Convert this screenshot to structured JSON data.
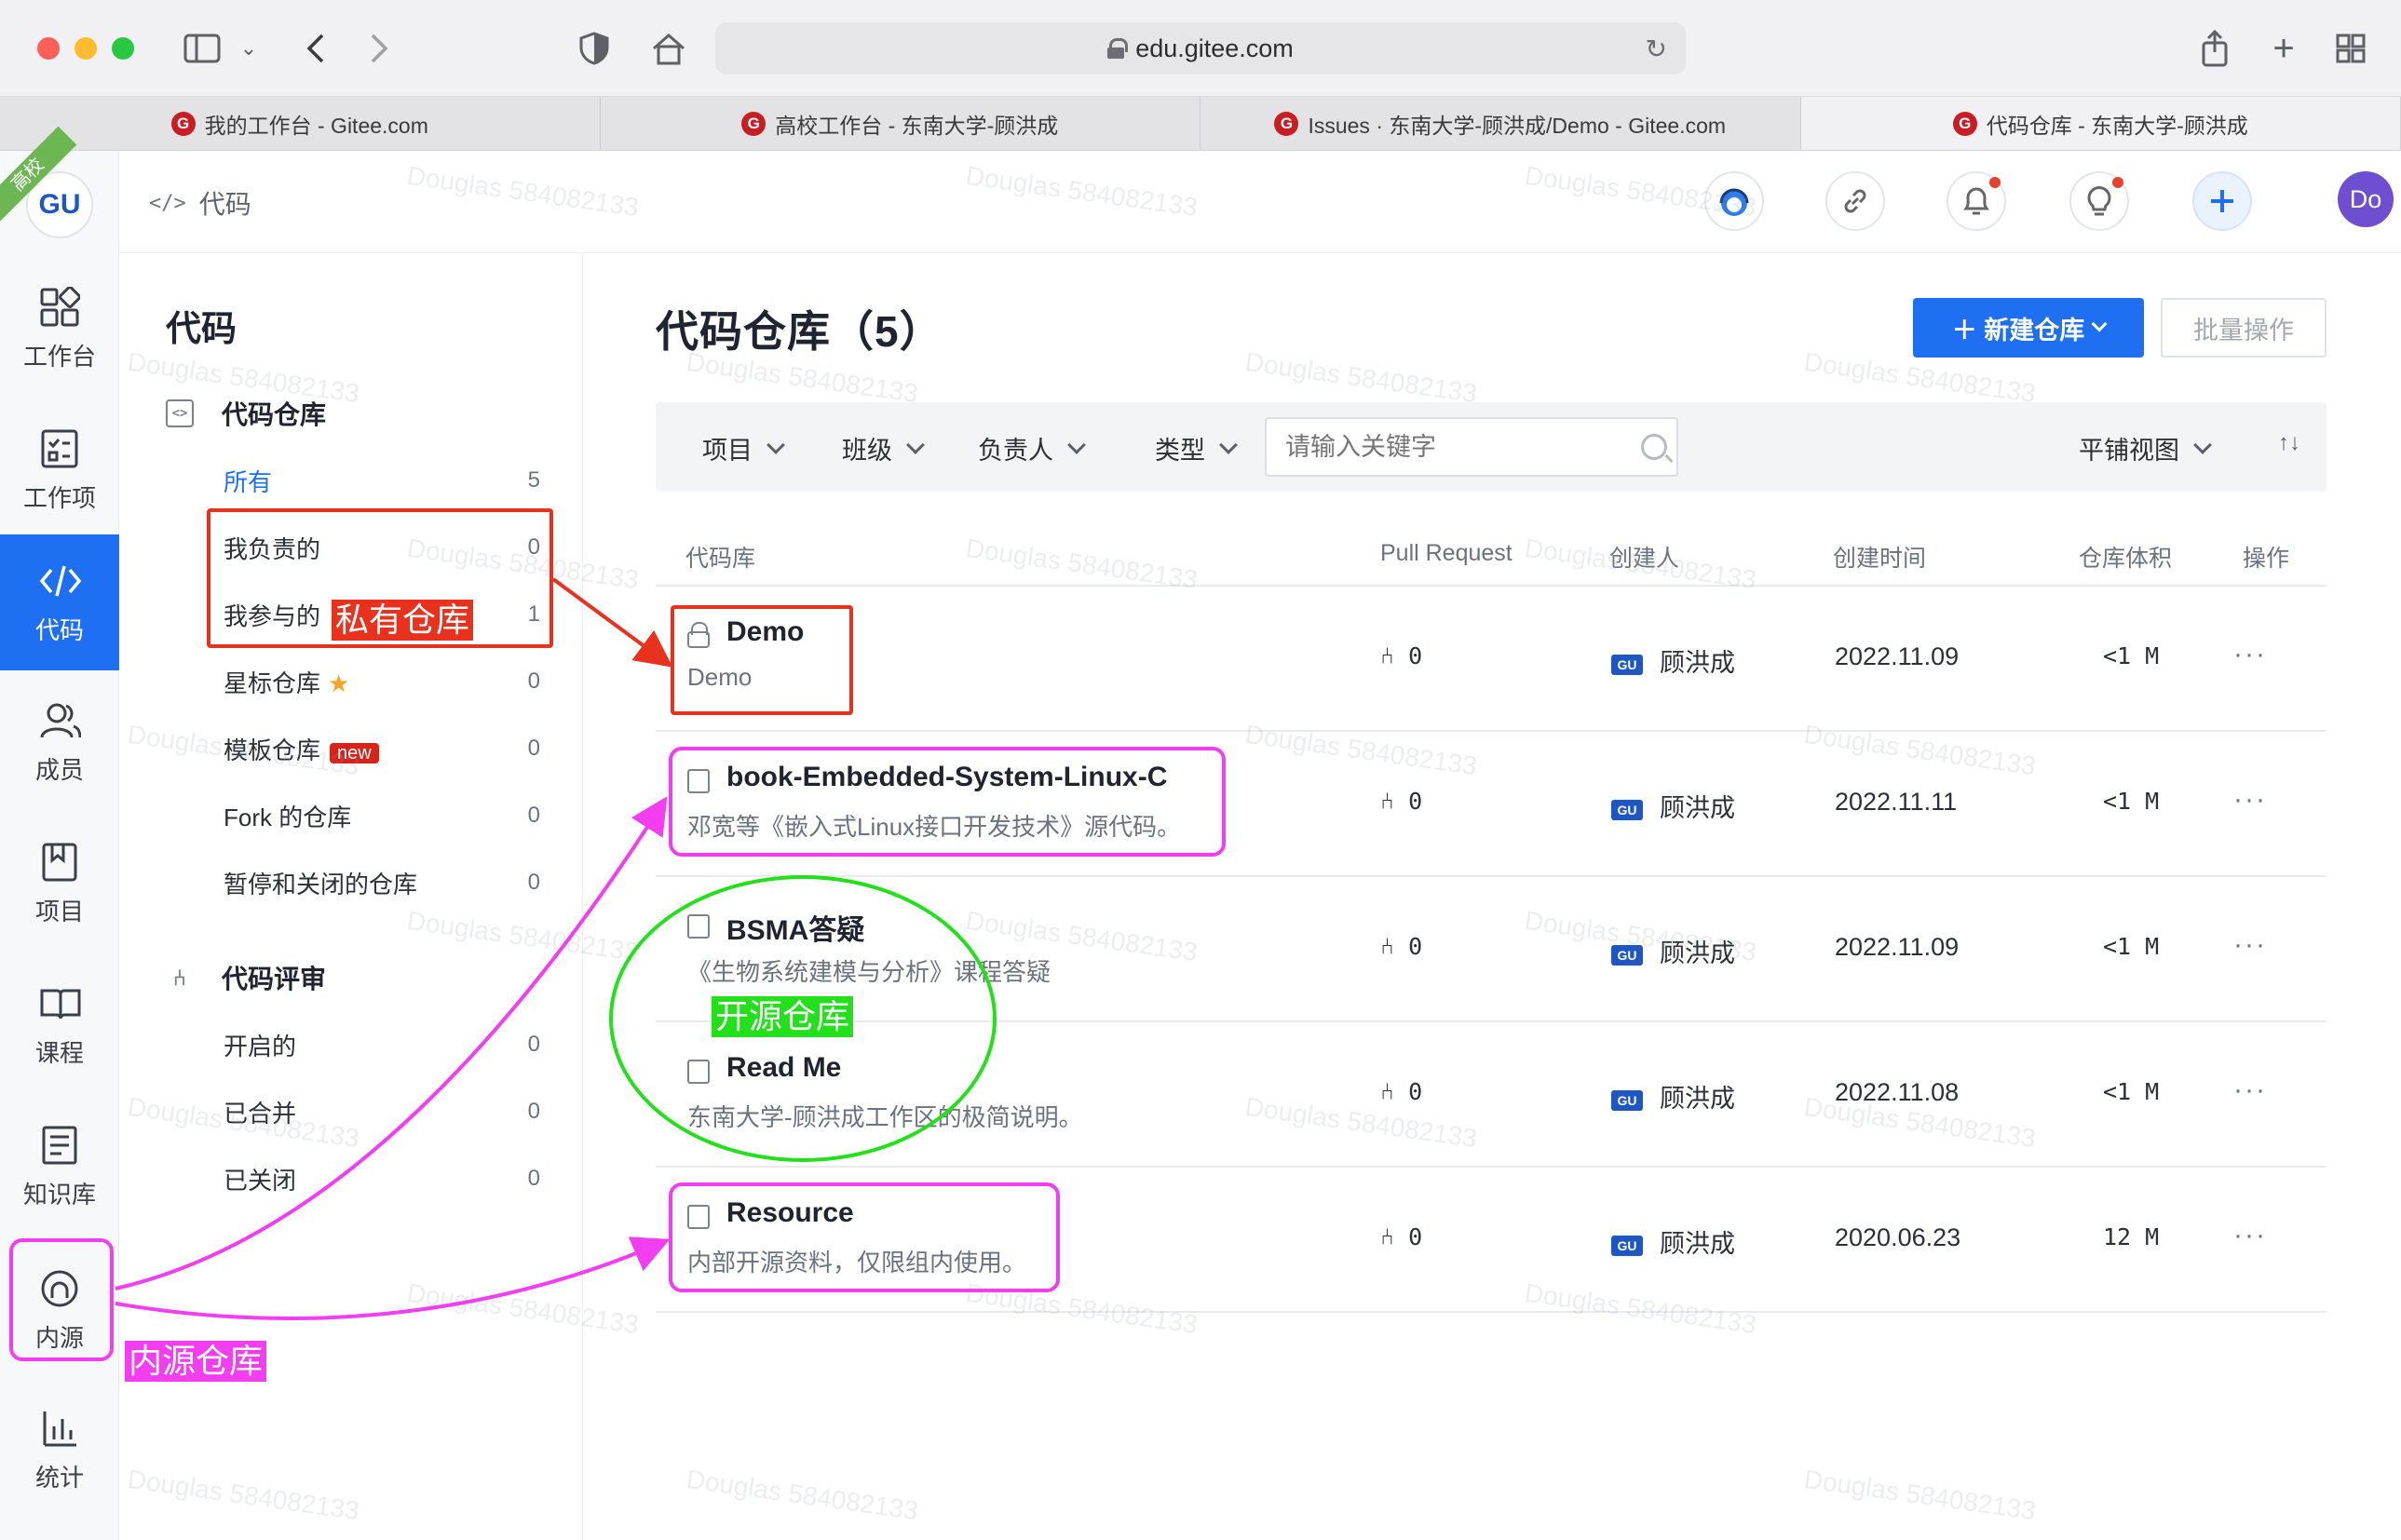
{
  "browser": {
    "url": "edu.gitee.com",
    "tabs": [
      {
        "title": "我的工作台 - Gitee.com",
        "icon": "gitee-icon"
      },
      {
        "title": "高校工作台 - 东南大学-顾洪成",
        "icon": "gitee-icon"
      },
      {
        "title": "Issues · 东南大学-顾洪成/Demo - Gitee.com",
        "icon": "gitee-icon"
      },
      {
        "title": "代码仓库 - 东南大学-顾洪成",
        "icon": "gitee-icon"
      }
    ],
    "active_tab": 3
  },
  "rail": {
    "ribbon": "高校",
    "logo_text": "GU",
    "items": [
      {
        "label": "工作台",
        "icon": "dashboard-icon"
      },
      {
        "label": "工作项",
        "icon": "checklist-icon"
      },
      {
        "label": "代码",
        "icon": "code-icon"
      },
      {
        "label": "成员",
        "icon": "members-icon"
      },
      {
        "label": "项目",
        "icon": "project-icon"
      },
      {
        "label": "课程",
        "icon": "course-icon"
      },
      {
        "label": "知识库",
        "icon": "knowledge-icon"
      },
      {
        "label": "内源",
        "icon": "innersource-icon"
      },
      {
        "label": "统计",
        "icon": "stats-icon"
      }
    ],
    "active": "代码"
  },
  "header": {
    "breadcrumb": "代码",
    "avatar_text": "Do"
  },
  "sidebar": {
    "title": "代码",
    "repo_group": "代码仓库",
    "repo_items": [
      {
        "label": "所有",
        "count": "5"
      },
      {
        "label": "我负责的",
        "count": "0"
      },
      {
        "label": "我参与的",
        "count": "1"
      },
      {
        "label": "星标仓库",
        "count": "0"
      },
      {
        "label": "模板仓库",
        "count": "0",
        "badge": "new"
      },
      {
        "label": "Fork 的仓库",
        "count": "0"
      },
      {
        "label": "暂停和关闭的仓库",
        "count": "0"
      }
    ],
    "review_group": "代码评审",
    "review_items": [
      {
        "label": "开启的",
        "count": "0"
      },
      {
        "label": "已合并",
        "count": "0"
      },
      {
        "label": "已关闭",
        "count": "0"
      }
    ]
  },
  "main": {
    "title": "代码仓库（5）",
    "new_repo_button": "＋ 新建仓库",
    "batch_button": "批量操作",
    "filters": [
      "项目",
      "班级",
      "负责人",
      "类型"
    ],
    "search_placeholder": "请输入关键字",
    "view_mode": "平铺视图",
    "sort_icon": "↑↓",
    "columns": [
      "代码库",
      "Pull Request",
      "创建人",
      "创建时间",
      "仓库体积",
      "操作"
    ],
    "rows": [
      {
        "name": "Demo",
        "desc": "Demo",
        "pr": "0",
        "creator": "顾洪成",
        "created": "2022.11.09",
        "size": "<1 M",
        "icon": "lock-icon"
      },
      {
        "name": "book-Embedded-System-Linux-C",
        "desc": "邓宽等《嵌入式Linux接口开发技术》源代码。",
        "pr": "0",
        "creator": "顾洪成",
        "created": "2022.11.11",
        "size": "<1 M",
        "icon": "internal-repo-icon"
      },
      {
        "name": "BSMA答疑",
        "desc": "《生物系统建模与分析》课程答疑",
        "pr": "0",
        "creator": "顾洪成",
        "created": "2022.11.09",
        "size": "<1 M",
        "icon": "public-repo-icon"
      },
      {
        "name": "Read Me",
        "desc": "东南大学-顾洪成工作区的极简说明。",
        "pr": "0",
        "creator": "顾洪成",
        "created": "2022.11.08",
        "size": "<1 M",
        "icon": "public-repo-icon"
      },
      {
        "name": "Resource",
        "desc": "内部开源资料，仅限组内使用。",
        "pr": "0",
        "creator": "顾洪成",
        "created": "2020.06.23",
        "size": "12 M",
        "icon": "internal-repo-icon"
      }
    ]
  },
  "annotations": {
    "private": "私有仓库",
    "open": "开源仓库",
    "inner": "内源仓库",
    "colors": {
      "red": "#e8321e",
      "green": "#22e01a",
      "magenta": "#f23ef0"
    }
  },
  "watermark": "Douglas 584082133"
}
